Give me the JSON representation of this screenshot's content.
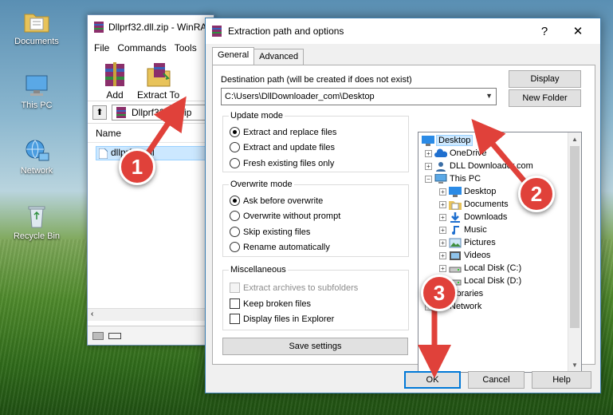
{
  "desktop": {
    "icons": [
      {
        "label": "Documents"
      },
      {
        "label": "This PC"
      },
      {
        "label": "Network"
      },
      {
        "label": "Recycle Bin"
      }
    ]
  },
  "winrar": {
    "title": "Dllprf32.dll.zip - WinRAR",
    "menu": [
      "File",
      "Commands",
      "Tools"
    ],
    "toolbar": [
      {
        "label": "Add",
        "icon": "add-archive-icon"
      },
      {
        "label": "Extract To",
        "icon": "extract-to-icon"
      }
    ],
    "path": "Dllprf32.dll.zip",
    "list_header": "Name",
    "list_row": "dllprf32.dll"
  },
  "dialog": {
    "title": "Extraction path and options",
    "help": "?",
    "close": "✕",
    "tabs": [
      {
        "label": "General",
        "active": true
      },
      {
        "label": "Advanced",
        "active": false
      }
    ],
    "destination_label": "Destination path (will be created if does not exist)",
    "destination_value": "C:\\Users\\DllDownloader_com\\Desktop",
    "display_button": "Display",
    "new_folder_button": "New Folder",
    "update_mode": {
      "title": "Update mode",
      "options": [
        {
          "label": "Extract and replace files",
          "checked": true
        },
        {
          "label": "Extract and update files",
          "checked": false
        },
        {
          "label": "Fresh existing files only",
          "checked": false
        }
      ]
    },
    "overwrite_mode": {
      "title": "Overwrite mode",
      "options": [
        {
          "label": "Ask before overwrite",
          "checked": true
        },
        {
          "label": "Overwrite without prompt",
          "checked": false
        },
        {
          "label": "Skip existing files",
          "checked": false
        },
        {
          "label": "Rename automatically",
          "checked": false
        }
      ]
    },
    "misc": {
      "title": "Miscellaneous",
      "options": [
        {
          "label": "Extract archives to subfolders",
          "checked": false,
          "disabled": true
        },
        {
          "label": "Keep broken files",
          "checked": false,
          "disabled": false
        },
        {
          "label": "Display files in Explorer",
          "checked": false,
          "disabled": false
        }
      ]
    },
    "save_settings": "Save settings",
    "tree": [
      {
        "label": "Desktop",
        "icon": "desktop-folder-icon",
        "selected": true
      },
      {
        "label": "OneDrive",
        "icon": "onedrive-cloud-icon",
        "selected": false
      },
      {
        "label": "DLL Downloader.com",
        "icon": "user-folder-icon",
        "selected": false
      },
      {
        "label": "This PC",
        "icon": "computer-icon",
        "selected": false
      },
      {
        "label": "Desktop",
        "icon": "desktop-folder-icon",
        "selected": false
      },
      {
        "label": "Documents",
        "icon": "documents-folder-icon",
        "selected": false
      },
      {
        "label": "Downloads",
        "icon": "downloads-folder-icon",
        "selected": false
      },
      {
        "label": "Music",
        "icon": "music-folder-icon",
        "selected": false
      },
      {
        "label": "Pictures",
        "icon": "pictures-folder-icon",
        "selected": false
      },
      {
        "label": "Videos",
        "icon": "videos-folder-icon",
        "selected": false
      },
      {
        "label": "Local Disk (C:)",
        "icon": "drive-icon",
        "selected": false
      },
      {
        "label": "Local Disk (D:)",
        "icon": "drive-icon",
        "selected": false
      },
      {
        "label": "Libraries",
        "icon": "libraries-folder-icon",
        "selected": false
      },
      {
        "label": "Network",
        "icon": "network-icon",
        "selected": false
      }
    ],
    "ok": "OK",
    "cancel": "Cancel",
    "help_button": "Help"
  },
  "annotations": {
    "step1": "1",
    "step2": "2",
    "step3": "3",
    "color": "#e0413a"
  }
}
